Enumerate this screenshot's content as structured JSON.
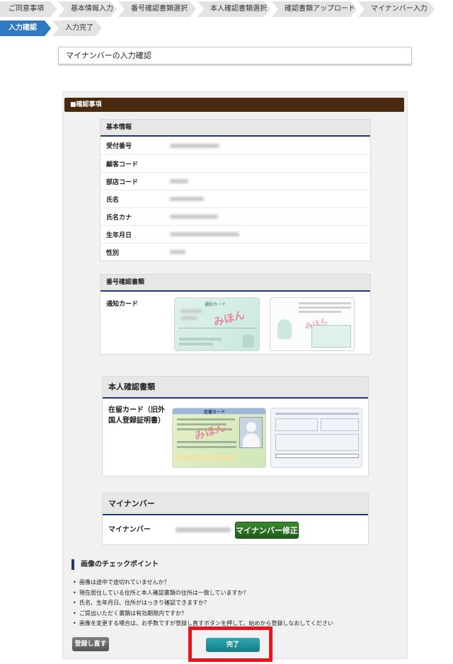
{
  "steps_row1": [
    {
      "label": "ご同意事項"
    },
    {
      "label": "基本情報入力"
    },
    {
      "label": "番号確認書類選択"
    },
    {
      "label": "本人確認書類選択"
    },
    {
      "label": "確認書類アップロード"
    },
    {
      "label": "マイナンバー入力"
    }
  ],
  "steps_row2": [
    {
      "label": "入力確認",
      "active": true
    },
    {
      "label": "入力完了"
    }
  ],
  "page_title": "マイナンバーの入力確認",
  "main_header": "■確認事項",
  "basic_info": {
    "title": "基本情報",
    "rows": [
      {
        "label": "受付番号"
      },
      {
        "label": "顧客コード"
      },
      {
        "label": "部店コード"
      },
      {
        "label": "氏名"
      },
      {
        "label": "氏名カナ"
      },
      {
        "label": "生年月日"
      },
      {
        "label": "性別"
      }
    ]
  },
  "number_doc": {
    "title": "番号確認書類",
    "label": "通知カード",
    "card_front_title": "通知カード",
    "card_watermark": "みほん"
  },
  "personal_doc": {
    "title": "本人確認書類",
    "label": "在留カード（旧外国人登録証明書）",
    "card_front_title": "在留カード",
    "card_watermark": "みほん"
  },
  "mynumber": {
    "title": "マイナンバー",
    "label": "マイナンバー",
    "edit_button": "マイナンバー修正"
  },
  "checkpoints": {
    "title": "画像のチェックポイント",
    "items": [
      "画像は途中で途切れていませんか？",
      "現在居住している住所と本人確認書類の住所は一致していますか？",
      "氏名、生年月日、住所がはっきり確認できますか？",
      "ご提出いただく書類は有効期限内ですか？",
      "画像を変更する場合は、お手数ですが登録し直すボタンを押して、始めから登録しなおしてください"
    ]
  },
  "buttons": {
    "redo": "登録し直す",
    "done": "完了"
  },
  "colors": {
    "active_step": "#2f78c4",
    "header_brown": "#4a2a0e",
    "highlight_red": "#e8161f",
    "done_teal": "#1f9aa1",
    "edit_green": "#2e7a28"
  }
}
